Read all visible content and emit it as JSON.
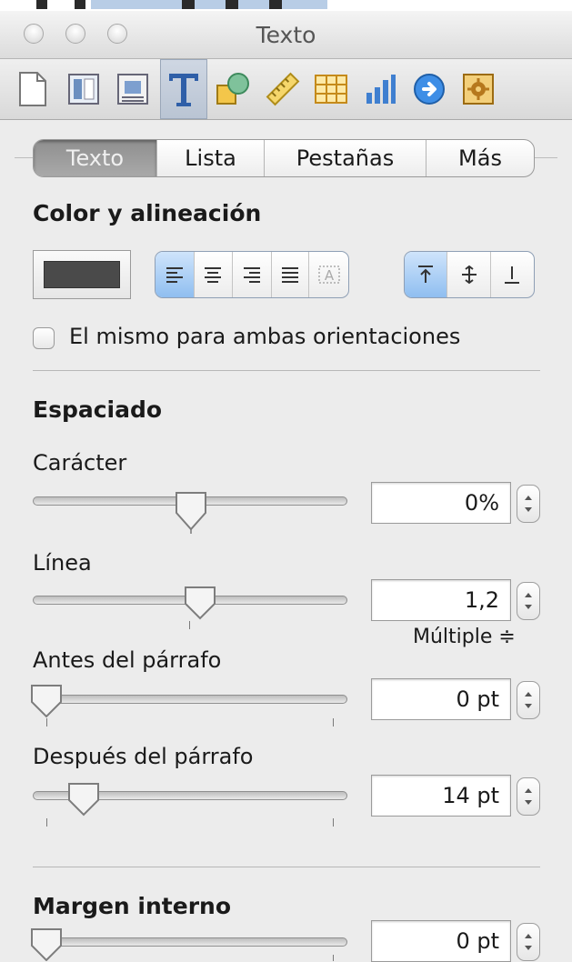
{
  "window": {
    "title": "Texto"
  },
  "toolbar": {
    "items": [
      {
        "id": "document",
        "icon": "document-icon"
      },
      {
        "id": "layout",
        "icon": "layout-icon"
      },
      {
        "id": "wrap",
        "icon": "wrap-icon"
      },
      {
        "id": "text",
        "icon": "text-icon",
        "active": true
      },
      {
        "id": "graphic",
        "icon": "graphic-icon"
      },
      {
        "id": "metrics",
        "icon": "ruler-icon"
      },
      {
        "id": "table",
        "icon": "table-icon"
      },
      {
        "id": "chart",
        "icon": "chart-icon"
      },
      {
        "id": "link",
        "icon": "link-icon"
      },
      {
        "id": "quicktime",
        "icon": "quicktime-icon"
      }
    ]
  },
  "tabs": [
    {
      "label": "Texto",
      "selected": true
    },
    {
      "label": "Lista",
      "selected": false
    },
    {
      "label": "Pestañas",
      "selected": false
    },
    {
      "label": "Más",
      "selected": false
    }
  ],
  "color_section": {
    "heading": "Color y alineación",
    "text_color": "#4a4a4a",
    "horizontal_align": [
      "left",
      "center",
      "right",
      "justify",
      "auto"
    ],
    "horizontal_selected": "left",
    "vertical_align": [
      "top",
      "middle",
      "bottom"
    ],
    "vertical_selected": "top",
    "same_orientation_label": "El mismo para ambas orientaciones",
    "same_orientation_checked": false
  },
  "spacing": {
    "heading": "Espaciado",
    "character": {
      "label": "Carácter",
      "value": "0%",
      "level": 0.5
    },
    "line": {
      "label": "Línea",
      "value": "1,2",
      "level": 0.5,
      "mode": "Múltiple ≑"
    },
    "before": {
      "label": "Antes del párrafo",
      "value": "0 pt",
      "level": 0.0
    },
    "after": {
      "label": "Después del párrafo",
      "value": "14 pt",
      "level": 0.17
    }
  },
  "inset": {
    "heading": "Margen interno",
    "value": "0 pt",
    "level": 0.0
  },
  "colors": {
    "accent": "#8fbef0",
    "tab_selected": "#9c9c9c"
  }
}
